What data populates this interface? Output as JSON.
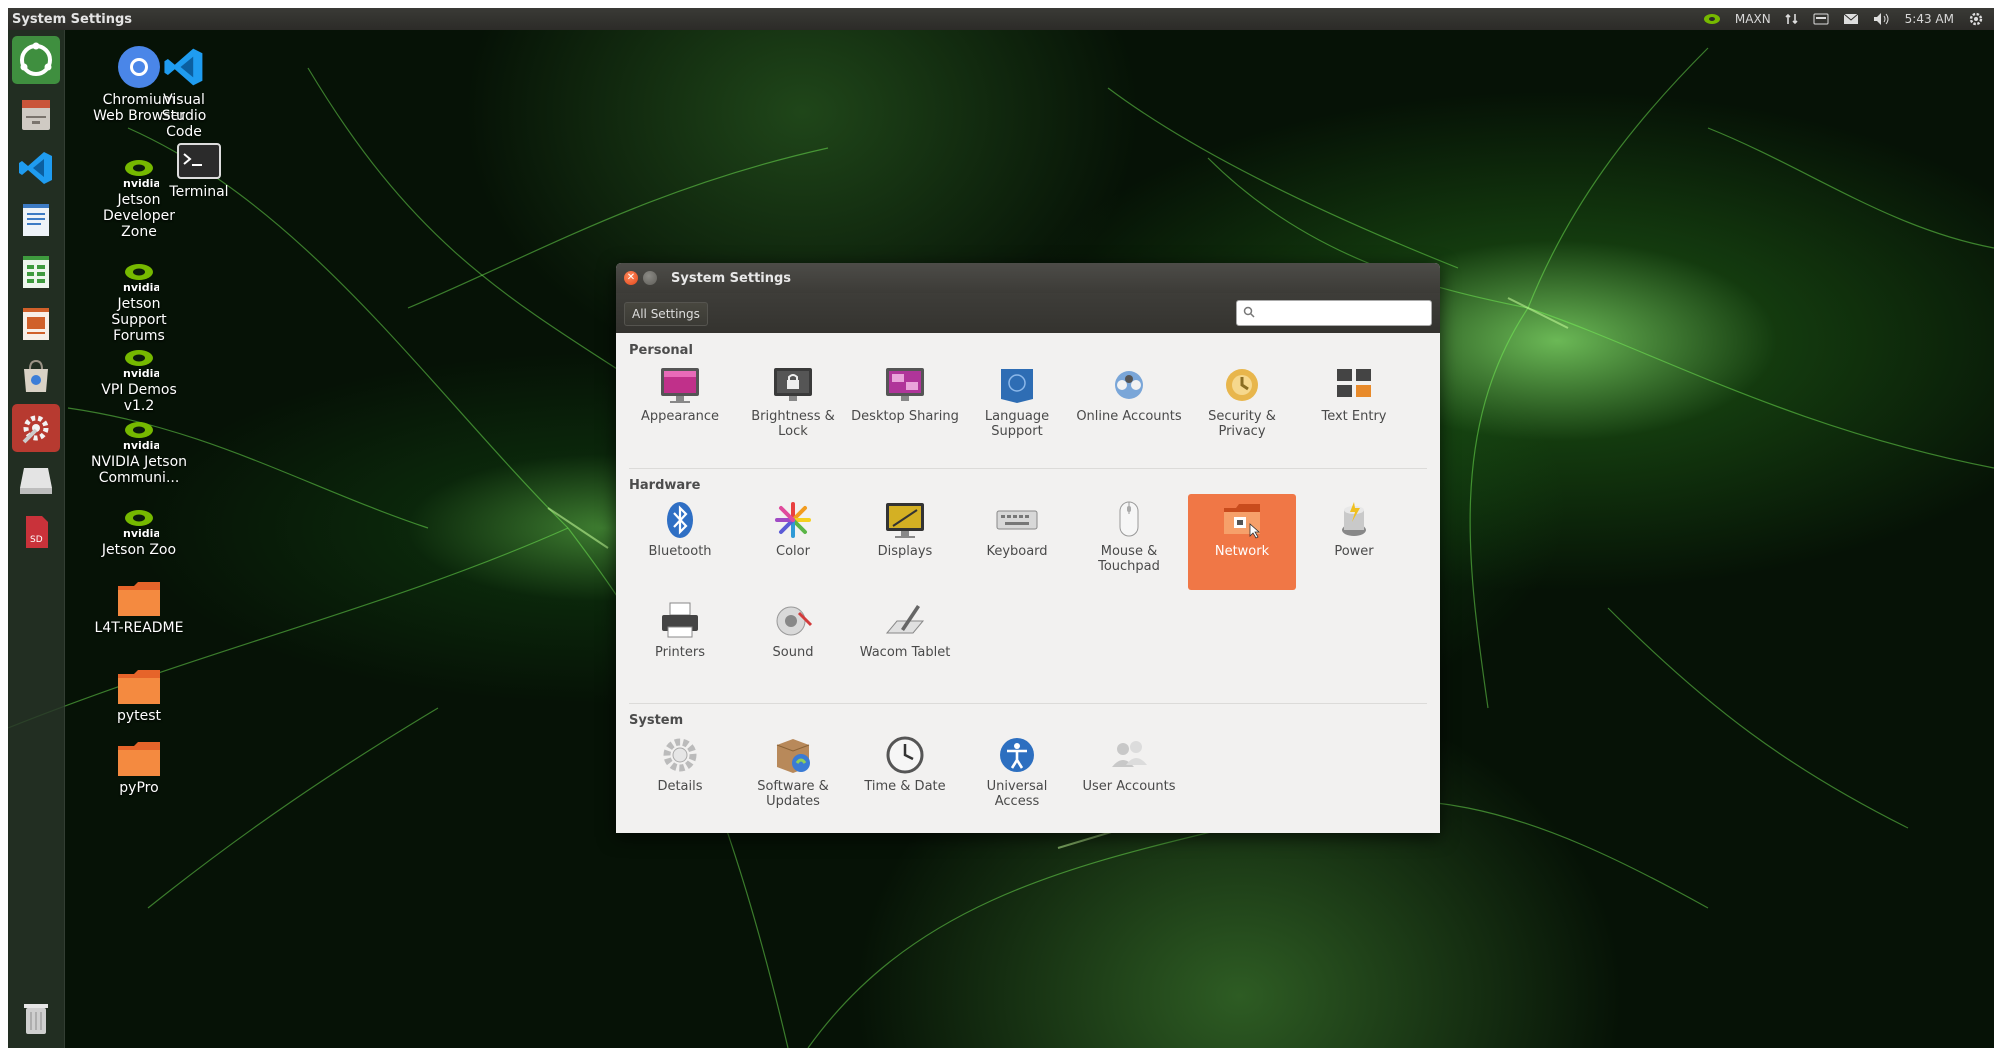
{
  "top_panel": {
    "title": "System Settings",
    "indicators": [
      "MAXN"
    ],
    "clock": "5:43 AM"
  },
  "launcher": {
    "items": [
      "dash-home",
      "file-manager",
      "visual-studio-code",
      "writer",
      "calc",
      "impress",
      "software-center",
      "system-settings",
      "disk-drive",
      "sd-card",
      "trash"
    ]
  },
  "desktop": {
    "icons": [
      {
        "label": "Chromium Web Browser"
      },
      {
        "label": "Visual Studio Code"
      },
      {
        "label": "Jetson Developer Zone"
      },
      {
        "label": "Terminal"
      },
      {
        "label": "Jetson Support Forums"
      },
      {
        "label": "VPI Demos v1.2"
      },
      {
        "label": "NVIDIA Jetson Communi..."
      },
      {
        "label": "Jetson Zoo"
      },
      {
        "label": "L4T-README"
      },
      {
        "label": "pytest"
      },
      {
        "label": "pyPro"
      }
    ],
    "nvidia_logo_text": "nvidia"
  },
  "window": {
    "title": "System Settings",
    "all_settings_label": "All Settings",
    "search": {
      "value": "",
      "placeholder": ""
    },
    "sections": {
      "personal": {
        "title": "Personal",
        "items": [
          "Appearance",
          "Brightness & Lock",
          "Desktop Sharing",
          "Language Support",
          "Online Accounts",
          "Security & Privacy",
          "Text Entry"
        ]
      },
      "hardware": {
        "title": "Hardware",
        "items": [
          "Bluetooth",
          "Color",
          "Displays",
          "Keyboard",
          "Mouse & Touchpad",
          "Network",
          "Power",
          "Printers",
          "Sound",
          "Wacom Tablet"
        ]
      },
      "system": {
        "title": "System",
        "items": [
          "Details",
          "Software & Updates",
          "Time & Date",
          "Universal Access",
          "User Accounts"
        ]
      }
    },
    "selected_item": "Network"
  },
  "colors": {
    "accent": "#f07746",
    "panel": "#3c3b37",
    "window_bg": "#f2f1f0",
    "wallpaper": "#061206"
  }
}
